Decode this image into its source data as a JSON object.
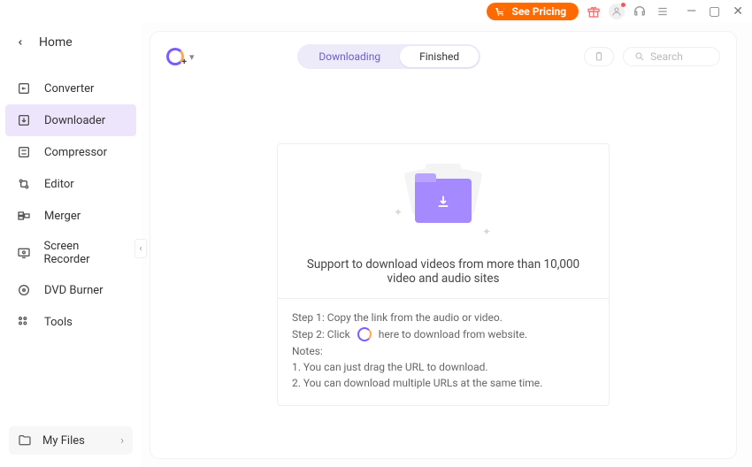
{
  "titlebar": {
    "pricing_label": "See Pricing"
  },
  "sidebar": {
    "home_label": "Home",
    "items": [
      {
        "label": "Converter"
      },
      {
        "label": "Downloader"
      },
      {
        "label": "Compressor"
      },
      {
        "label": "Editor"
      },
      {
        "label": "Merger"
      },
      {
        "label": "Screen Recorder"
      },
      {
        "label": "DVD Burner"
      },
      {
        "label": "Tools"
      }
    ],
    "my_files_label": "My Files"
  },
  "tabs": {
    "downloading": "Downloading",
    "finished": "Finished"
  },
  "search": {
    "placeholder": "Search"
  },
  "card": {
    "support_text": "Support to download videos from more than 10,000 video and audio sites",
    "step1": "Step 1: Copy the link from the audio or video.",
    "step2a": "Step 2: Click",
    "step2b": "here to download from website.",
    "notes_label": "Notes:",
    "note1": "1. You can just drag the URL to download.",
    "note2": "2. You can download multiple URLs at the same time."
  }
}
